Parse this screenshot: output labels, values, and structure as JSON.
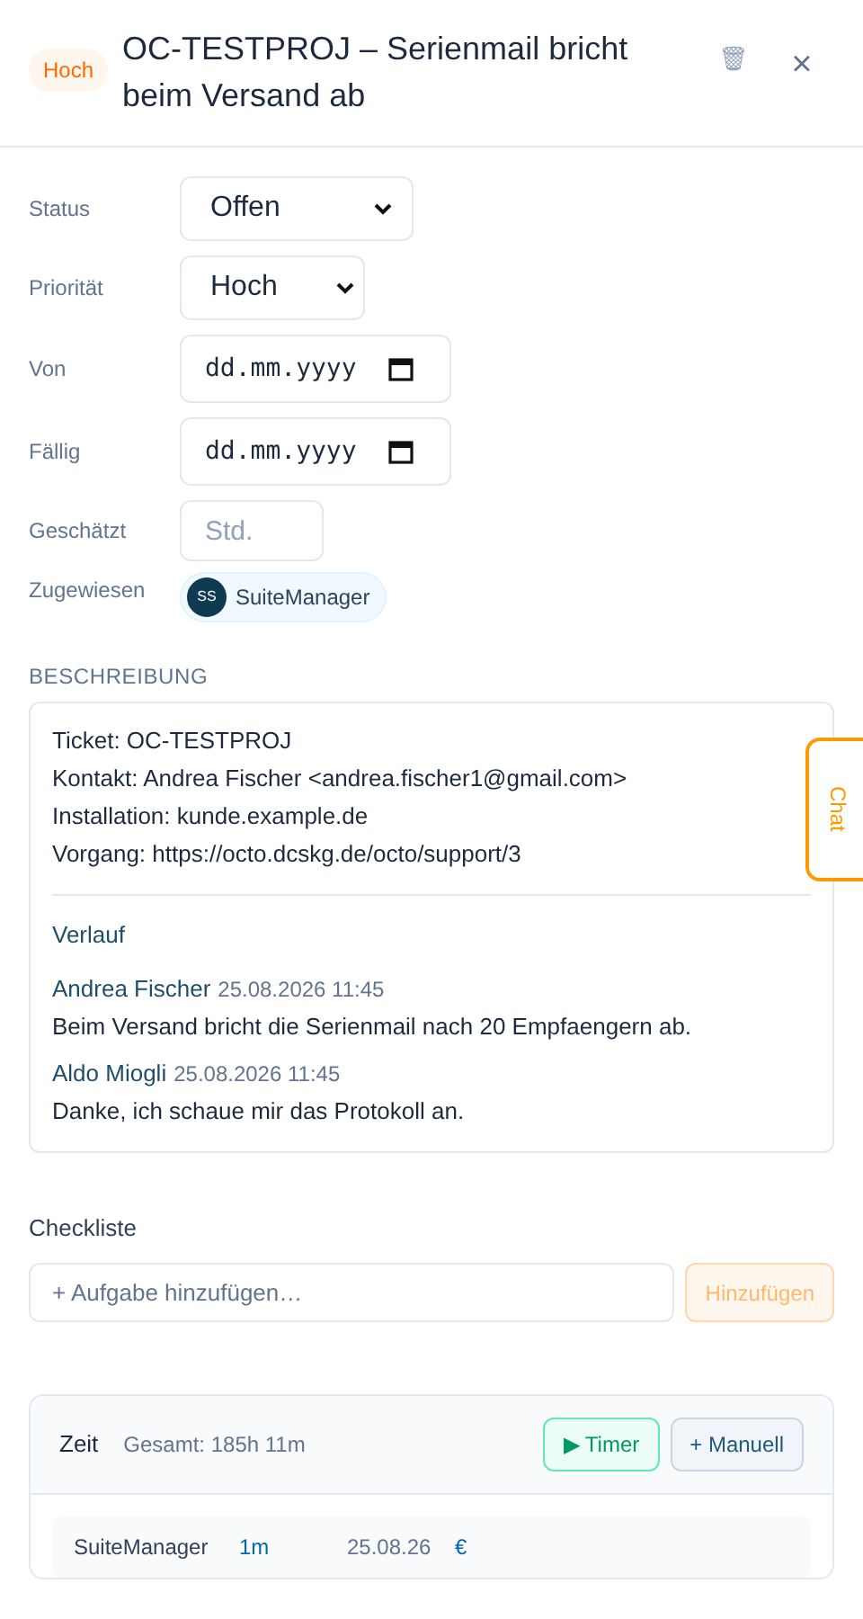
{
  "header": {
    "priority_badge": "Hoch",
    "title": "OC-TESTPROJ – Serienmail bricht beim Versand ab",
    "delete_icon": "🗑",
    "close_icon": "×"
  },
  "fields": [
    {
      "kind": "select",
      "label": "Status",
      "value": "Offen"
    },
    {
      "kind": "select",
      "label": "Priorität",
      "value": "Hoch"
    },
    {
      "kind": "date",
      "label": "Von",
      "placeholder": "dd.mm.yyyy"
    },
    {
      "kind": "date",
      "label": "Fällig",
      "placeholder": "dd.mm.yyyy"
    },
    {
      "kind": "text",
      "label": "Geschätzt",
      "placeholder": "Std."
    },
    {
      "kind": "assignee",
      "label": "Zugewiesen",
      "initials": "SS",
      "name": "SuiteManager"
    }
  ],
  "description": {
    "heading": "BESCHREIBUNG",
    "lines": [
      "Ticket: OC-TESTPROJ",
      "Kontakt: Andrea Fischer <andrea.fischer1@gmail.com>",
      "Installation: kunde.example.de",
      "Vorgang: https://octo.dcskg.de/octo/support/3"
    ],
    "history_title": "Verlauf",
    "entries": [
      {
        "author": "Andrea Fischer",
        "time": "25.08.2026 11:45",
        "text": "Beim Versand bricht die Serienmail nach 20 Empfaengern ab."
      },
      {
        "author": "Aldo Miogli",
        "time": "25.08.2026 11:45",
        "text": "Danke, ich schaue mir das Protokoll an."
      }
    ]
  },
  "chat_tab": "Chat",
  "checklist": {
    "title": "Checkliste",
    "placeholder": "+ Aufgabe hinzufügen…",
    "add_button": "Hinzufügen"
  },
  "time": {
    "title": "Zeit",
    "total": "Gesamt: 185h 11m",
    "timer_button": "▶ Timer",
    "manual_button": "+ Manuell",
    "rows": [
      {
        "user": "SuiteManager",
        "duration": "1m",
        "date": "25.08.26",
        "billing": "€"
      }
    ]
  }
}
